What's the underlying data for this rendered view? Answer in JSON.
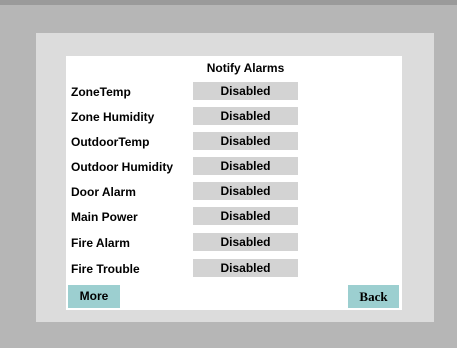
{
  "panel": {
    "heading": "Notify Alarms"
  },
  "alarms": [
    {
      "label": "ZoneTemp",
      "value": "Disabled"
    },
    {
      "label": "Zone Humidity",
      "value": "Disabled"
    },
    {
      "label": "OutdoorTemp",
      "value": "Disabled"
    },
    {
      "label": "Outdoor Humidity",
      "value": "Disabled"
    },
    {
      "label": "Door Alarm",
      "value": "Disabled"
    },
    {
      "label": "Main Power",
      "value": "Disabled"
    },
    {
      "label": "Fire Alarm",
      "value": "Disabled"
    },
    {
      "label": "Fire Trouble",
      "value": "Disabled"
    }
  ],
  "nav": {
    "more_label": "More",
    "back_label": "Back"
  },
  "colors": {
    "bezel": "#b6b6b6",
    "frame": "#dcdcdc",
    "status_button": "#d3d3d3",
    "nav_button": "#9ccfd0"
  }
}
